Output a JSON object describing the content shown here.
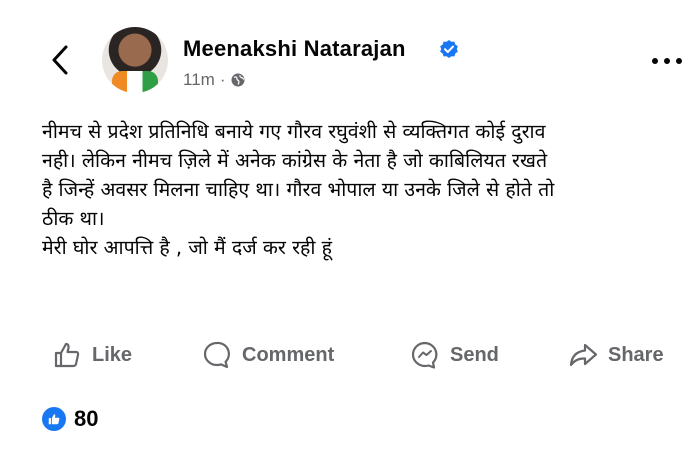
{
  "post": {
    "author": "Meenakshi Natarajan",
    "time": "11m",
    "meta_separator": "·",
    "text_lines": [
      "नीमच से प्रदेश प्रतिनिधि बनाये गए गौरव रघुवंशी से व्यक्तिगत कोई दुराव",
      "नही। लेकिन नीमच ज़िले में अनेक कांग्रेस के नेता है जो काबिलियत रखते",
      "है जिन्हें अवसर मिलना चाहिए था। गौरव भोपाल या उनके जिले से होते तो",
      "ठीक था।",
      "मेरी घोर आपत्ति है , जो मैं दर्ज कर रही हूं"
    ]
  },
  "actions": {
    "like": "Like",
    "comment": "Comment",
    "send": "Send",
    "share": "Share"
  },
  "reactions": {
    "count": "80"
  },
  "colors": {
    "facebook_blue": "#1877f2",
    "secondary_text": "#65676b"
  },
  "icons": {
    "back": "chevron-left-icon",
    "verified": "verified-badge-icon",
    "audience": "globe-icon",
    "more": "more-options-icon",
    "like": "thumbs-up-icon",
    "comment": "comment-bubble-icon",
    "send": "messenger-icon",
    "share": "share-arrow-icon"
  }
}
